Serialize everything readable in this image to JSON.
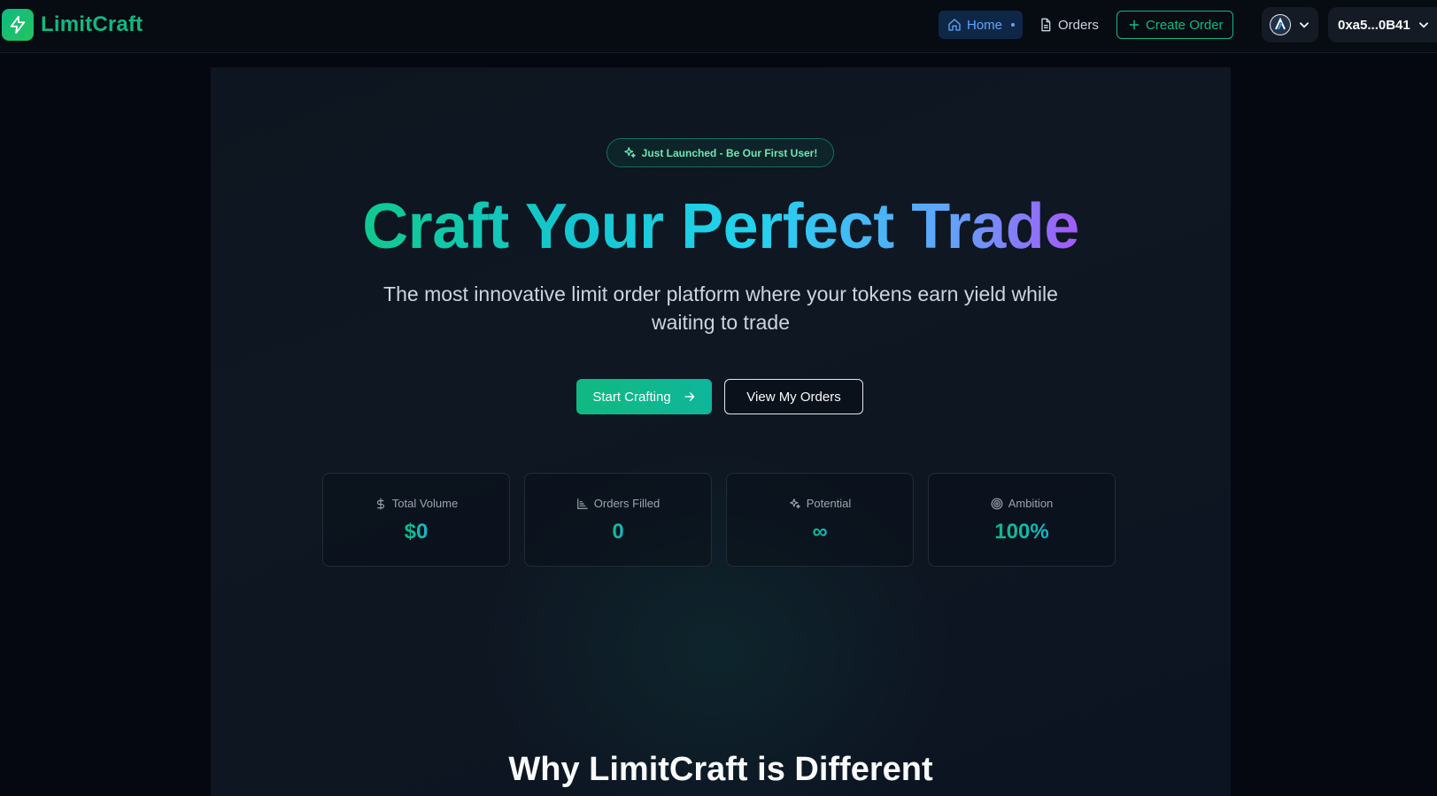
{
  "brand": {
    "name": "LimitCraft",
    "icon": "lightning-bolt-icon"
  },
  "nav": {
    "home_label": "Home",
    "orders_label": "Orders",
    "create_label": "Create Order"
  },
  "wallet": {
    "chain_icon": "arbitrum-logo-icon",
    "account_label": "0xa5...0B41"
  },
  "hero": {
    "badge_text": "Just Launched - Be Our First User!",
    "headline": "Craft Your Perfect Trade",
    "subheadline": "The most innovative limit order platform where your tokens earn yield while waiting to trade",
    "primary_cta": "Start Crafting",
    "secondary_cta": "View My Orders"
  },
  "stats": [
    {
      "label": "Total Volume",
      "value": "$0",
      "icon": "dollar-icon"
    },
    {
      "label": "Orders Filled",
      "value": "0",
      "icon": "chart-icon"
    },
    {
      "label": "Potential",
      "value": "∞",
      "icon": "sparkles-icon"
    },
    {
      "label": "Ambition",
      "value": "100%",
      "icon": "target-icon"
    }
  ],
  "section": {
    "heading": "Why LimitCraft is Different"
  },
  "colors": {
    "accent": "#10b981",
    "nav_active_text": "#60a5fa",
    "background": "#050810",
    "hero_background": "#0f1722"
  }
}
